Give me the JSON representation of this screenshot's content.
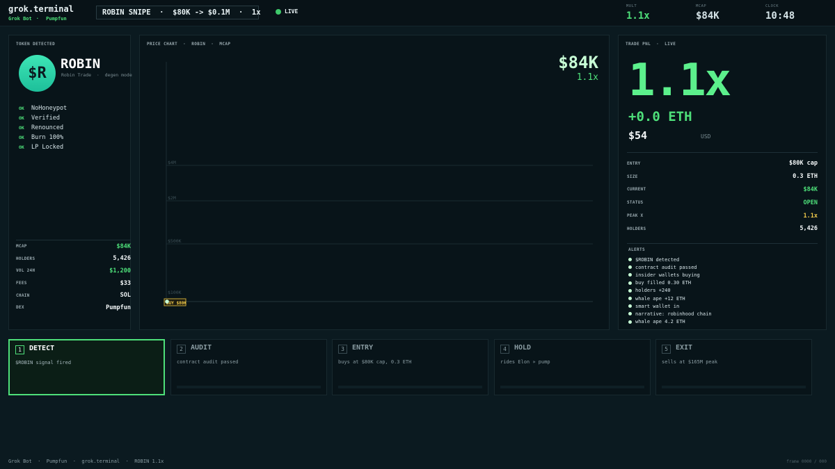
{
  "brand": {
    "title": "grok.terminal",
    "tag1": "Grok Bot",
    "sep": "·",
    "tag2": "Pumpfun"
  },
  "ticker": "ROBIN SNIPE  ·  $80K -> $0.1M  ·  1x",
  "live": "LIVE",
  "header_stats": [
    {
      "label": "MULT",
      "value": "1.1x",
      "color": "#4ee07a"
    },
    {
      "label": "MCAP",
      "value": "$84K",
      "color": "#e8f2f4"
    },
    {
      "label": "CLOCK",
      "value": "10:48",
      "color": "#e8f2f4"
    }
  ],
  "token": {
    "panel_title": "TOKEN DETECTED",
    "logo": "$R",
    "name": "ROBIN",
    "subtitle": "Robin Trade  ·  degen mode",
    "checks": [
      {
        "status": "OK",
        "label": "NoHoneypot"
      },
      {
        "status": "OK",
        "label": "Verified"
      },
      {
        "status": "OK",
        "label": "Renounced"
      },
      {
        "status": "OK",
        "label": "Burn 100%"
      },
      {
        "status": "OK",
        "label": "LP Locked"
      }
    ],
    "stats": [
      {
        "key": "MCAP",
        "value": "$84K",
        "color": "#4ee07a"
      },
      {
        "key": "HOLDERS",
        "value": "5,426",
        "color": "#f2f6f7"
      },
      {
        "key": "VOL 24H",
        "value": "$1,200",
        "color": "#4ee07a"
      },
      {
        "key": "FEES",
        "value": "$33",
        "color": "#f2f6f7"
      },
      {
        "key": "CHAIN",
        "value": "SOL",
        "color": "#f2f6f7"
      },
      {
        "key": "DEX",
        "value": "Pumpfun",
        "color": "#f2f6f7"
      }
    ]
  },
  "chart": {
    "panel_title": "PRICE CHART  ·  ROBIN  ·  MCAP",
    "mcap": "$84K",
    "mult": "1.1x",
    "marker_label": "BUY $80K",
    "grid_labels": [
      "$4M",
      "$2M",
      "$500K",
      "$100K"
    ]
  },
  "chart_data": {
    "type": "line",
    "title": "PRICE CHART · ROBIN · MCAP",
    "y_ticks": [
      "$4M",
      "$2M",
      "$500K",
      "$100K"
    ],
    "series": [
      {
        "values": [
          80000,
          84000
        ]
      }
    ],
    "annotations": [
      "BUY $80K"
    ]
  },
  "pnl": {
    "panel_title": "TRADE PNL  ·  LIVE",
    "mult": "1.1x",
    "eth": "+0.0 ETH",
    "usd": "$54",
    "usd_label": "USD",
    "stats": [
      {
        "key": "ENTRY",
        "value": "$80K cap",
        "color": "#f2f6f7"
      },
      {
        "key": "SIZE",
        "value": "0.3 ETH",
        "color": "#f2f6f7"
      },
      {
        "key": "CURRENT",
        "value": "$84K",
        "color": "#4ee07a"
      },
      {
        "key": "STATUS",
        "value": "OPEN",
        "color": "#4ee07a"
      },
      {
        "key": "PEAK X",
        "value": "1.1x",
        "color": "#f0c94a"
      },
      {
        "key": "HOLDERS",
        "value": "5,426",
        "color": "#f2f6f7"
      }
    ],
    "alerts_title": "ALERTS",
    "alerts": [
      "$ROBIN detected",
      "contract audit passed",
      "insider wallets buying",
      "buy filled 0.30 ETH",
      "holders +240",
      "whale ape +12 ETH",
      "smart wallet in",
      "narrative: robinhood chain",
      "whale ape 4.2 ETH"
    ]
  },
  "steps": [
    {
      "num": "1",
      "title": "DETECT",
      "desc": "$ROBIN signal fired",
      "active": true
    },
    {
      "num": "2",
      "title": "AUDIT",
      "desc": "contract audit passed",
      "active": false
    },
    {
      "num": "3",
      "title": "ENTRY",
      "desc": "buys at $80K cap, 0.3 ETH",
      "active": false
    },
    {
      "num": "4",
      "title": "HOLD",
      "desc": "rides Elon » pump",
      "active": false
    },
    {
      "num": "5",
      "title": "EXIT",
      "desc": "sells at $165M peak",
      "active": false
    }
  ],
  "footer": "Grok Bot  ·  Pumpfun  ·  grok.terminal  ·  ROBIN 1.1x",
  "frame": "frame 0000 / 000"
}
